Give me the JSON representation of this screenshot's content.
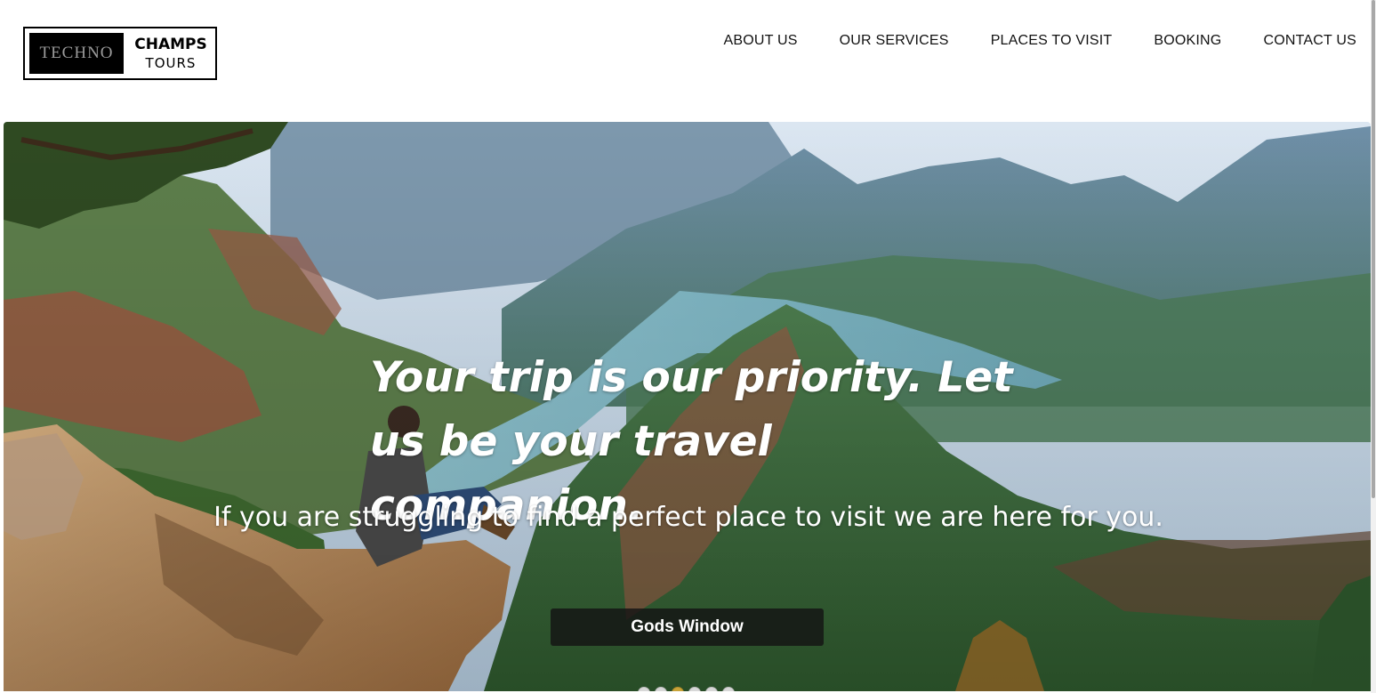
{
  "logo": {
    "left_text": "TECHNO",
    "right_top": "CHAMPS",
    "right_bottom": "TOURS"
  },
  "nav": {
    "items": [
      "ABOUT US",
      "OUR SERVICES",
      "PLACES TO VISIT",
      "BOOKING",
      "CONTACT US"
    ]
  },
  "hero": {
    "title": "Your trip is our priority. Let us be your travel companion.",
    "subtitle": "If you are struggling to find a perfect place to visit we are here for you.",
    "caption_button": "Gods Window",
    "slides_count": 6,
    "active_slide": 3
  },
  "colors": {
    "accent_dot": "#c9a43a",
    "caption_bg": "#141414",
    "text_white": "#ffffff"
  }
}
